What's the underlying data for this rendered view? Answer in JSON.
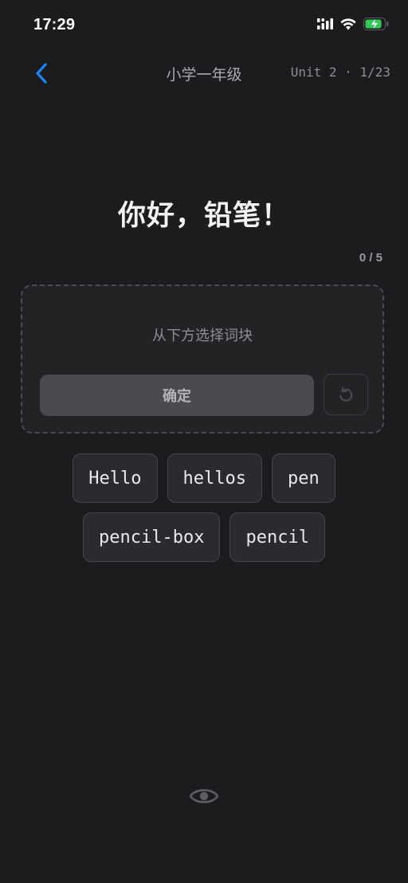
{
  "status_bar": {
    "time": "17:29",
    "icons": [
      "cellular-signal-icon",
      "wifi-icon",
      "battery-charging-icon"
    ],
    "battery_color": "#34c759"
  },
  "nav": {
    "back_icon": "chevron-left-icon",
    "accent_color": "#1a84ff",
    "title": "小学一年级",
    "progress": "Unit 2 · 1/23"
  },
  "exercise": {
    "prompt": "你好，铅笔！",
    "counter": "0 / 5",
    "answer_placeholder": "从下方选择词块",
    "confirm_label": "确定",
    "reset_icon": "undo-icon"
  },
  "word_chips": [
    [
      "Hello",
      "hellos",
      "pen"
    ],
    [
      "pencil-box",
      "pencil"
    ]
  ],
  "footer": {
    "reveal_icon": "eye-icon"
  }
}
